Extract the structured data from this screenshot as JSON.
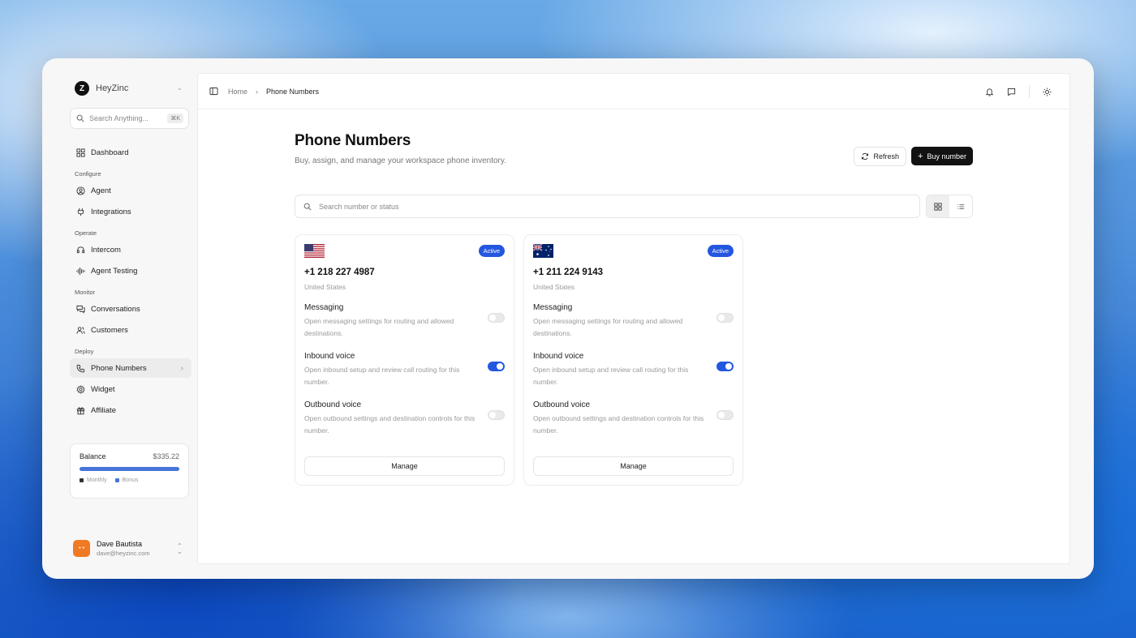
{
  "app": {
    "name": "HeyZinc"
  },
  "search": {
    "placeholder": "Search Anything...",
    "shortcut": "⌘K"
  },
  "sidebar": {
    "dashboard": "Dashboard",
    "sections": {
      "configure": "Configure",
      "operate": "Operate",
      "monitor": "Monitor",
      "deploy": "Deploy"
    },
    "items": {
      "agent": "Agent",
      "integrations": "Integrations",
      "intercom": "Intercom",
      "agent_testing": "Agent Testing",
      "conversations": "Conversations",
      "customers": "Customers",
      "phone_numbers": "Phone Numbers",
      "widget": "Widget",
      "affiliate": "Affiliate"
    }
  },
  "balance": {
    "label": "Balance",
    "amount": "$335.22",
    "legend_monthly": "Monthly",
    "legend_bonus": "Bonus",
    "monthly_color": "#333333",
    "bonus_color": "#4774d8"
  },
  "user": {
    "name": "Dave Bautista",
    "email": "dave@heyzinc.com",
    "avatar_text": "• •"
  },
  "breadcrumb": {
    "home": "Home",
    "current": "Phone Numbers"
  },
  "page": {
    "title": "Phone Numbers",
    "subtitle": "Buy, assign, and manage your workspace phone inventory.",
    "refresh": "Refresh",
    "buy": "Buy number",
    "filter_placeholder": "Search number or status"
  },
  "cards": [
    {
      "flag": "us-flag",
      "status": "Active",
      "number": "+1 218 227 4987",
      "country": "United States",
      "messaging_title": "Messaging",
      "messaging_desc": "Open messaging settings for routing and allowed destinations.",
      "messaging_on": false,
      "inbound_title": "Inbound voice",
      "inbound_desc": "Open inbound setup and review call routing for this number.",
      "inbound_on": true,
      "outbound_title": "Outbound voice",
      "outbound_desc": "Open outbound settings and destination controls for this number.",
      "outbound_on": false,
      "manage": "Manage"
    },
    {
      "flag": "au-flag",
      "status": "Active",
      "number": "+1 211 224 9143",
      "country": "United States",
      "messaging_title": "Messaging",
      "messaging_desc": "Open messaging settings for routing and allowed destinations.",
      "messaging_on": false,
      "inbound_title": "Inbound voice",
      "inbound_desc": "Open inbound setup and review call routing for this number.",
      "inbound_on": true,
      "outbound_title": "Outbound voice",
      "outbound_desc": "Open outbound settings and destination controls for this number.",
      "outbound_on": false,
      "manage": "Manage"
    }
  ],
  "colors": {
    "accent": "#2457e0",
    "button_dark": "#121212",
    "avatar": "#f07a24"
  }
}
